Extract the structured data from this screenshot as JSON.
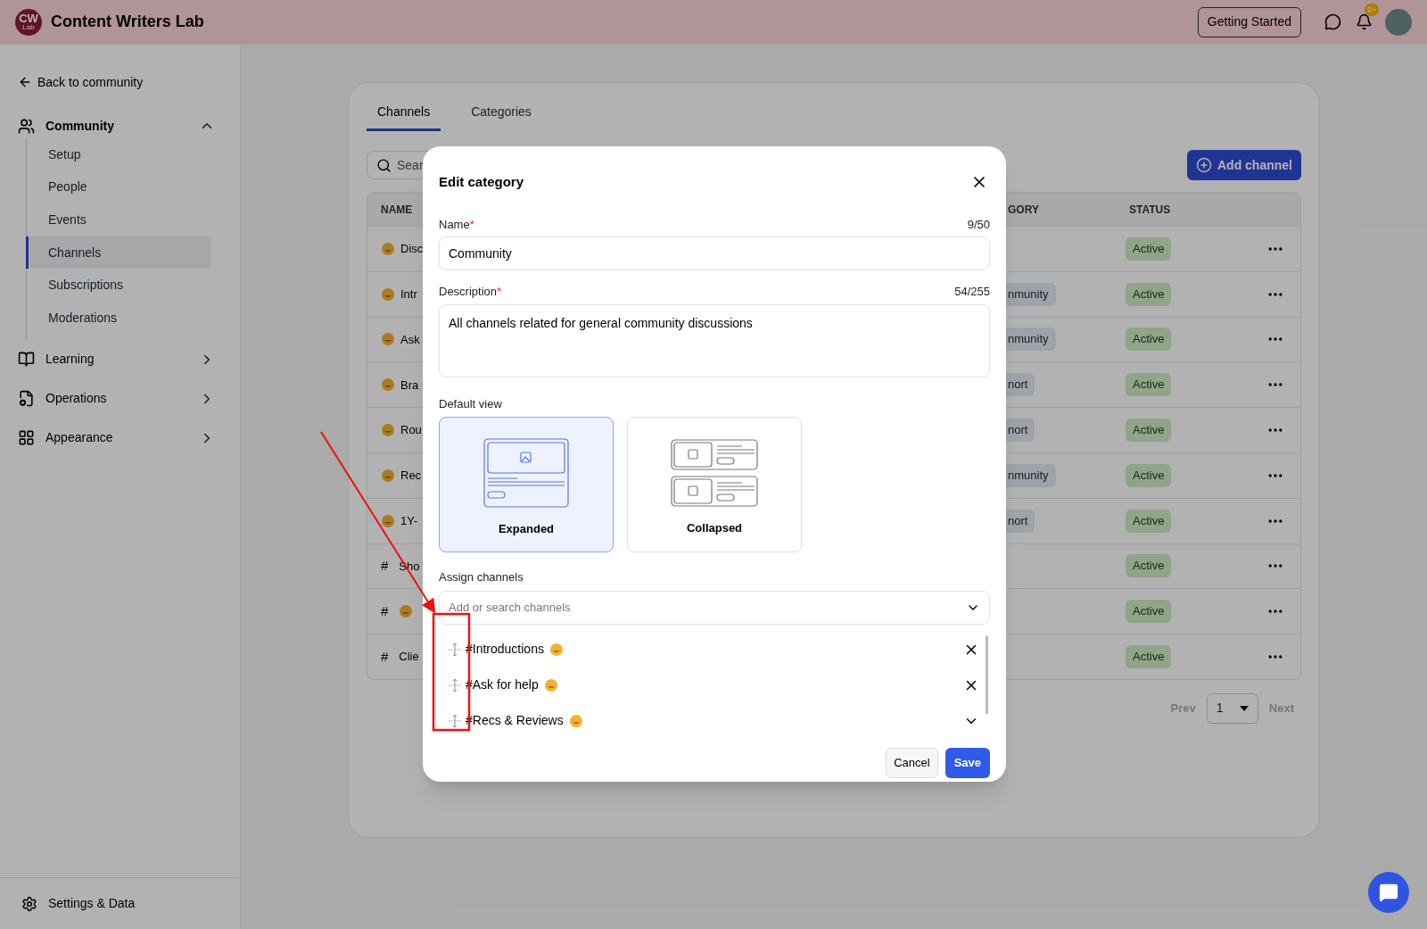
{
  "header": {
    "logo": "CW",
    "logo_sub": "Lab",
    "title": "Content Writers Lab",
    "getting_started": "Getting Started",
    "badge": "9+"
  },
  "sidebar": {
    "back": "Back to community",
    "groups": [
      {
        "label": "Community",
        "expanded": true,
        "children": [
          {
            "label": "Setup",
            "selected": false
          },
          {
            "label": "People",
            "selected": false
          },
          {
            "label": "Events",
            "selected": false
          },
          {
            "label": "Channels",
            "selected": true
          },
          {
            "label": "Subscriptions",
            "selected": false
          },
          {
            "label": "Moderations",
            "selected": false
          }
        ]
      },
      {
        "label": "Learning",
        "expanded": false
      },
      {
        "label": "Operations",
        "expanded": false
      },
      {
        "label": "Appearance",
        "expanded": false
      }
    ],
    "footer": "Settings & Data"
  },
  "main": {
    "tabs": [
      {
        "label": "Channels",
        "selected": true
      },
      {
        "label": "Categories",
        "selected": false
      }
    ],
    "search_placeholder": "Sear",
    "add_button": "Add channel",
    "table": {
      "columns": [
        "NAME",
        "GORY",
        "STATUS"
      ],
      "rows": [
        {
          "emoji": true,
          "name": "Disc",
          "status": "Active"
        },
        {
          "emoji": true,
          "name": "Intr",
          "category": "nmunity",
          "status": "Active"
        },
        {
          "emoji": true,
          "name": "Ask",
          "category": "nmunity",
          "status": "Active"
        },
        {
          "emoji": true,
          "name": "Bra",
          "category": "nort",
          "status": "Active"
        },
        {
          "emoji": true,
          "name": "Rou",
          "category": "nort",
          "status": "Active"
        },
        {
          "emoji": true,
          "name": "Rec",
          "category": "nmunity",
          "status": "Active"
        },
        {
          "emoji": true,
          "name": "1Y-",
          "category": "nort",
          "status": "Active"
        },
        {
          "hash": "#",
          "emoji": false,
          "name": "Sho",
          "status": "Active"
        },
        {
          "hash": "#",
          "emoji": true,
          "status": "Active"
        },
        {
          "hash": "#",
          "emoji": false,
          "name": "Clie",
          "status": "Active"
        }
      ]
    },
    "pagination": {
      "prev": "Prev",
      "page": "1",
      "next": "Next"
    }
  },
  "modal": {
    "title": "Edit category",
    "name": {
      "label": "Name",
      "required_mark": "*",
      "count": "9/50",
      "value": "Community"
    },
    "description": {
      "label": "Description",
      "required_mark": "*",
      "count": "54/255",
      "value": "All channels related for general community discussions"
    },
    "default_view": {
      "label": "Default view",
      "options": [
        {
          "label": "Expanded",
          "kind": "expanded",
          "selected": true
        },
        {
          "label": "Collapsed",
          "kind": "collapsed",
          "selected": false
        }
      ]
    },
    "assign": {
      "label": "Assign channels",
      "placeholder": "Add or search channels",
      "items": [
        {
          "label": "#Introductions",
          "kind": "removable"
        },
        {
          "label": "#Ask for help",
          "kind": "removable"
        },
        {
          "label": "#Recs & Reviews",
          "kind": "expandable"
        }
      ]
    },
    "cancel": "Cancel",
    "save": "Save"
  }
}
